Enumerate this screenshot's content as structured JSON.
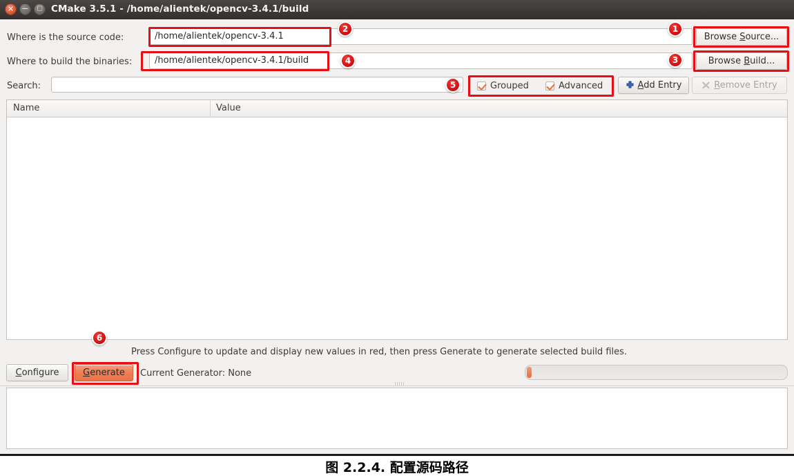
{
  "window": {
    "title": "CMake 3.5.1 - /home/alientek/opencv-3.4.1/build",
    "controls": {
      "close": "close-icon",
      "minimize": "minimize-icon",
      "maximize": "maximize-icon"
    }
  },
  "source_row": {
    "label": "Where is the source code:",
    "value": "/home/alientek/opencv-3.4.1",
    "browse_button": "Browse Source..."
  },
  "build_row": {
    "label": "Where to build the binaries:",
    "value": "/home/alientek/opencv-3.4.1/build",
    "browse_button": "Browse Build..."
  },
  "search_row": {
    "label": "Search:",
    "value": "",
    "placeholder": "",
    "grouped_label": "Grouped",
    "grouped_checked": true,
    "advanced_label": "Advanced",
    "advanced_checked": true,
    "add_entry_label": "Add Entry",
    "remove_entry_label": "Remove Entry",
    "remove_entry_disabled": true
  },
  "cache_table": {
    "columns": [
      "Name",
      "Value"
    ],
    "rows": []
  },
  "hint_text": "Press Configure to update and display new values in red, then press Generate to generate selected build files.",
  "bottom_bar": {
    "configure_label": "Configure",
    "generate_label": "Generate",
    "generator_status": "Current Generator: None",
    "progress_percent": 0
  },
  "output_log": "",
  "annotations": {
    "accent_color": "#e60f14",
    "badges": [
      {
        "n": "1",
        "target": "browse-source-button"
      },
      {
        "n": "2",
        "target": "source-path-field"
      },
      {
        "n": "3",
        "target": "browse-build-button"
      },
      {
        "n": "4",
        "target": "build-path-field"
      },
      {
        "n": "5",
        "target": "grouped-advanced-group"
      },
      {
        "n": "6",
        "target": "generate-button"
      }
    ]
  },
  "figure_caption": "图 2.2.4. 配置源码路径"
}
